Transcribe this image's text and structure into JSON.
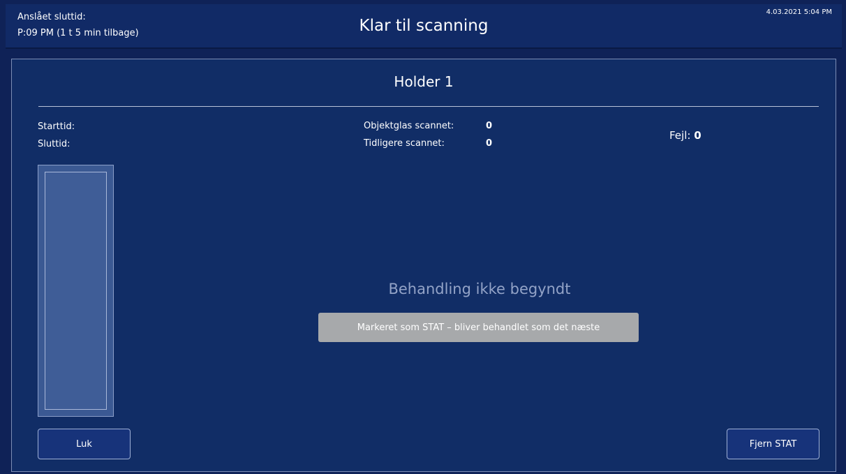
{
  "header": {
    "estimated_end_label": "Anslået sluttid:",
    "estimated_end_value": "P:09 PM (1 t 5 min tilbage)",
    "title": "Klar til scanning",
    "datetime": "4.03.2021 5:04 PM"
  },
  "panel": {
    "title": "Holder 1",
    "start_label": "Starttid:",
    "end_label": "Sluttid:",
    "scanned_label": "Objektglas scannet:",
    "scanned_value": "0",
    "previously_label": "Tidligere scannet:",
    "previously_value": "0",
    "errors_label": "Fejl:",
    "errors_value": "0",
    "status_text": "Behandling ikke begyndt",
    "stat_badge": "Markeret som STAT – bliver behandlet som det næste"
  },
  "buttons": {
    "close": "Luk",
    "remove_stat": "Fjern STAT"
  },
  "colors": {
    "background": "#0f2257",
    "panel": "#112d66",
    "badge": "#a7a9ab"
  }
}
